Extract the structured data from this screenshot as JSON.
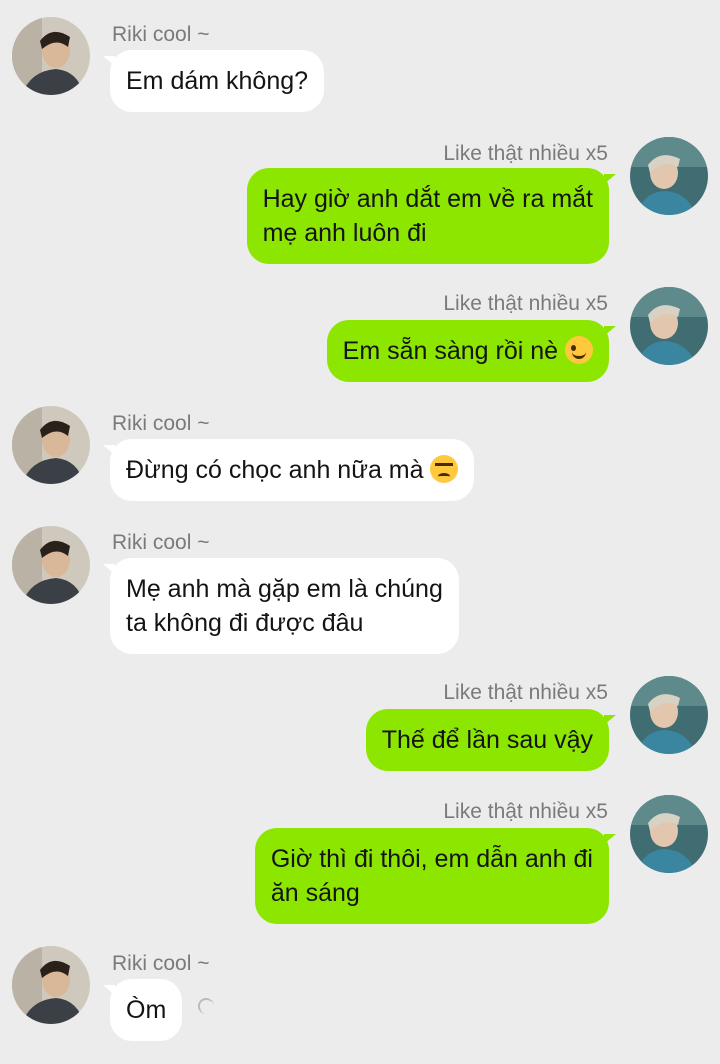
{
  "conversation": {
    "contact_name": "Riki cool ~",
    "my_name": "Like thật nhiều x5",
    "colors": {
      "background": "#ececec",
      "incoming_bubble": "#ffffff",
      "outgoing_bubble": "#8ce600",
      "name_text": "#7a7a7a"
    },
    "messages": [
      {
        "sender": "Riki cool ~",
        "lines": [
          "Em dám không?"
        ]
      },
      {
        "sender": "Like thật nhiều x5",
        "lines": [
          "Hay giờ anh dắt em về ra mắt",
          "mẹ anh luôn đi"
        ]
      },
      {
        "sender": "Like thật nhiều x5",
        "lines": [
          "Em sẵn sàng rồi nè"
        ],
        "emoji": "winking-face-icon"
      },
      {
        "sender": "Riki cool ~",
        "lines": [
          "Đừng có chọc anh nữa mà"
        ],
        "emoji": "persevering-face-icon"
      },
      {
        "sender": "Riki cool ~",
        "lines": [
          "Mẹ anh mà gặp em là chúng",
          "ta không đi được đâu"
        ]
      },
      {
        "sender": "Like thật nhiều x5",
        "lines": [
          "Thế để lần sau vậy"
        ]
      },
      {
        "sender": "Like thật nhiều x5",
        "lines": [
          "Giờ thì đi thôi, em dẫn anh đi",
          "ăn sáng"
        ]
      },
      {
        "sender": "Riki cool ~",
        "lines": [
          "Òm"
        ]
      }
    ]
  }
}
